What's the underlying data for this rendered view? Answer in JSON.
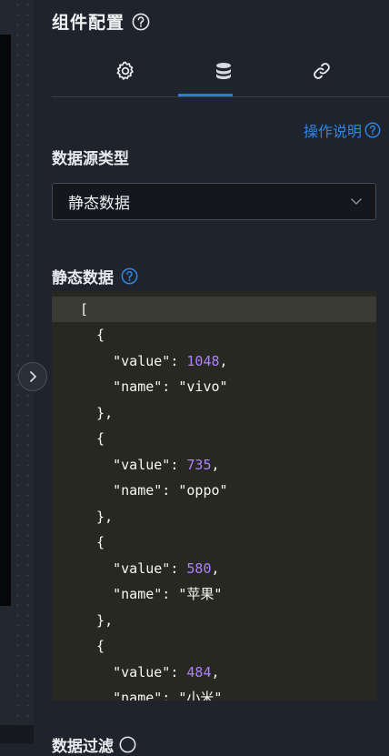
{
  "panel": {
    "title": "组件配置"
  },
  "tabs": [
    {
      "icon": "gear-icon"
    },
    {
      "icon": "database-icon"
    },
    {
      "icon": "link-icon"
    }
  ],
  "help_link": "操作说明",
  "datasource": {
    "label": "数据源类型",
    "selected": "静态数据"
  },
  "static_data": {
    "label": "静态数据",
    "lines": [
      "[",
      "  {",
      "    \"value\": 1048,",
      "    \"name\": \"vivo\"",
      "  },",
      "  {",
      "    \"value\": 735,",
      "    \"name\": \"oppo\"",
      "  },",
      "  {",
      "    \"value\": 580,",
      "    \"name\": \"苹果\"",
      "  },",
      "  {",
      "    \"value\": 484,",
      "    \"name\": \"小米\""
    ]
  },
  "data_filter": {
    "label": "数据过滤"
  },
  "colors": {
    "accent": "#2f7ad8",
    "link": "#2f86e6",
    "number": "#ae81ff",
    "editor_bg": "#272822"
  }
}
